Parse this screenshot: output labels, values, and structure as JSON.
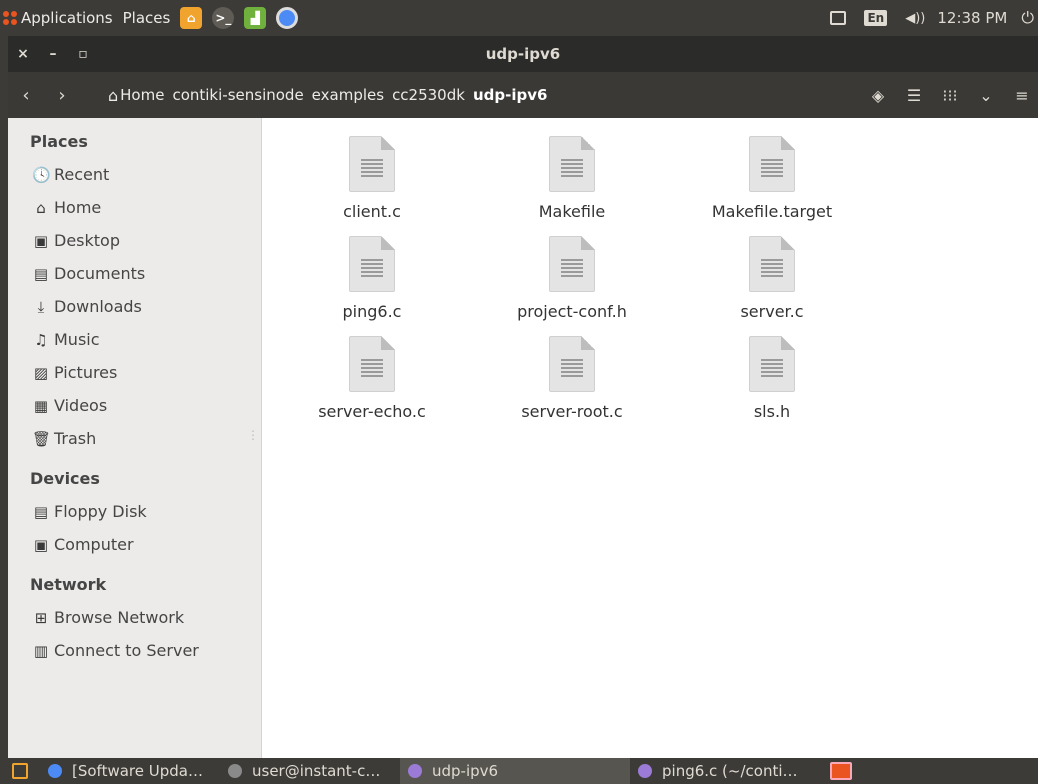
{
  "top_panel": {
    "applications_label": "Applications",
    "places_label": "Places",
    "lang": "En",
    "volume": "◀))",
    "clock": "12:38 PM",
    "power": "⏻",
    "accent": "#e95420"
  },
  "window": {
    "close": "×",
    "minimize": "–",
    "maximize": "▫",
    "title": "udp-ipv6"
  },
  "toolbar": {
    "back": "‹",
    "forward": "›",
    "breadcrumbs": [
      "Home",
      "contiki-sensinode",
      "examples",
      "cc2530dk",
      "udp-ipv6"
    ],
    "location_icon": "◈",
    "list_view_icon": "☰",
    "grid_view_icon": "⁝⁝⁝",
    "dropdown_icon": "⌄",
    "menu_icon": "≡"
  },
  "sidebar": {
    "places_header": "Places",
    "places": [
      {
        "label": "Recent",
        "icon": "🕓"
      },
      {
        "label": "Home",
        "icon": "⌂"
      },
      {
        "label": "Desktop",
        "icon": "▣"
      },
      {
        "label": "Documents",
        "icon": "▤"
      },
      {
        "label": "Downloads",
        "icon": "⤓"
      },
      {
        "label": "Music",
        "icon": "♫"
      },
      {
        "label": "Pictures",
        "icon": "▨"
      },
      {
        "label": "Videos",
        "icon": "▦"
      },
      {
        "label": "Trash",
        "icon": "🗑"
      }
    ],
    "devices_header": "Devices",
    "devices": [
      {
        "label": "Floppy Disk",
        "icon": "▤"
      },
      {
        "label": "Computer",
        "icon": "▣"
      }
    ],
    "network_header": "Network",
    "network": [
      {
        "label": "Browse Network",
        "icon": "⊞"
      },
      {
        "label": "Connect to Server",
        "icon": "▥"
      }
    ]
  },
  "files": [
    "client.c",
    "Makefile",
    "Makefile.target",
    "ping6.c",
    "project-conf.h",
    "server.c",
    "server-echo.c",
    "server-root.c",
    "sls.h"
  ],
  "taskbar": {
    "tasks": [
      {
        "label": "[Software Upda…",
        "color": "#4c8bf5"
      },
      {
        "label": "user@instant-c…",
        "color": "#8a8a8a"
      },
      {
        "label": "udp-ipv6",
        "color": "#9b7bd6"
      },
      {
        "label": "ping6.c (~/conti…",
        "color": "#9b7bd6"
      }
    ]
  }
}
